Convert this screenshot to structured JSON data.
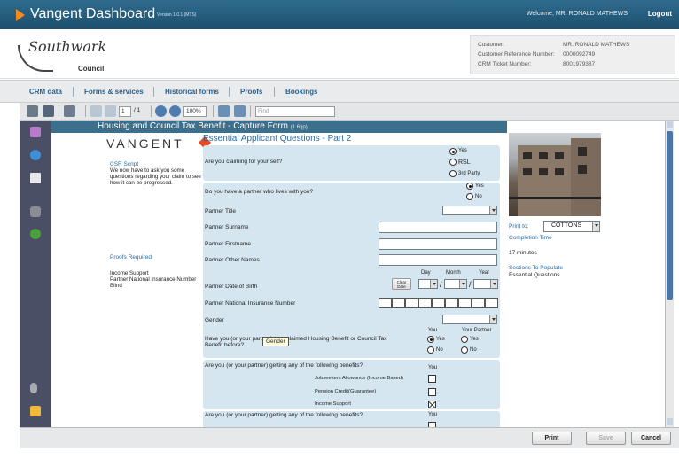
{
  "titlebar": {
    "title": "Vangent Dashboard",
    "version": "Version 1.0.1 (MTS)",
    "welcome": "Welcome, MR. RONALD MATHEWS",
    "logout": "Logout",
    "accent_color": "#f28a1e"
  },
  "header": {
    "council_name": "Southwark",
    "council_sub": "Council",
    "customer_label": "Customer:",
    "customer_value": "MR. RONALD MATHEWS",
    "ref_label": "Customer Reference Number:",
    "ref_value": "0000092749",
    "ticket_label": "CRM Ticket Number:",
    "ticket_value": "8001979387"
  },
  "nav": {
    "items": [
      "CRM data",
      "Forms & services",
      "Historical forms",
      "Proofs",
      "Bookings"
    ]
  },
  "toolbar": {
    "page_current": "1",
    "page_total": "/ 1",
    "zoom": "100%",
    "find_placeholder": "Find"
  },
  "form": {
    "header_title": "Housing and Council Tax Benefit - Capture Form",
    "header_sub": "(1.6qp)",
    "vangent_logo": "VANGENT",
    "csr_title": "CSR Script",
    "csr_text": "We now have to ask you some questions regarding your claim to see how it can be progressed.",
    "proofs_title": "Proofs Required",
    "proofs": [
      "Income Support",
      "Partner National Insurance Number",
      "Blind"
    ],
    "section_title": "Essential Applicant Questions - Part 2",
    "q_self": "Are you claiming for your self?",
    "q_self_options": [
      "Yes",
      "RSL",
      "3rd Party"
    ],
    "q_partner": "Do you have a partner who lives with you?",
    "q_partner_options": [
      "Yes",
      "No"
    ],
    "partner_title": "Partner Title",
    "partner_surname": "Partner Surname",
    "partner_firstname": "Partner Firstname",
    "partner_other": "Partner Other Names",
    "partner_dob": "Partner Date of Birth",
    "dob_day": "Day",
    "dob_month": "Month",
    "dob_year": "Year",
    "clear_date": "Clear Date",
    "partner_ni": "Partner National Insurance Number",
    "gender": "Gender",
    "q_claimed": "Have you (or your partner) ever claimed Housing Benefit or Council Tax Benefit before?",
    "col_you": "You",
    "col_partner": "Your Partner",
    "yes": "Yes",
    "no": "No",
    "q_benefits": "Are you (or your partner) getting any of the following benefits?",
    "benefits": [
      "Jobseekers Allowance (Income Based)",
      "Pension Credit(Guarantee)",
      "Income Support"
    ],
    "benefits_checked": [
      false,
      false,
      true
    ],
    "q_benefits2": "Are you (or your partner) getting any of the following benefits?",
    "tooltip": "Gender"
  },
  "right_panel": {
    "print_to_label": "Print to:",
    "print_to_value": "COTTONS",
    "completion_label": "Completion Time",
    "completion_value": "17 minutes",
    "sections_label": "Sections To Populate",
    "sections_value": "Essential Questions"
  },
  "footer": {
    "print": "Print",
    "save": "Save",
    "cancel": "Cancel"
  }
}
